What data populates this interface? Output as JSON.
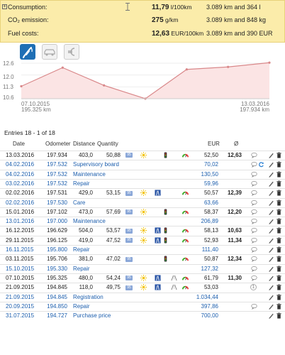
{
  "summary": {
    "rows": [
      {
        "label": "Consumption:",
        "value": "11,79",
        "unit": " l/100km",
        "total": "3.089 km and 364 l"
      },
      {
        "label": "CO₂ emission:",
        "value": "275",
        "unit": " g/km",
        "total": "3.089 km and 848 kg"
      },
      {
        "label": "Fuel costs:",
        "value": "12,63",
        "unit": " EUR/100km",
        "total": "3.089 km and 390 EUR"
      }
    ],
    "bg_color": "#fbecaa"
  },
  "tabs": [
    {
      "icon": "fuel-pump-icon",
      "active": true
    },
    {
      "icon": "car-icon",
      "active": false
    },
    {
      "icon": "euro-icon",
      "active": false
    }
  ],
  "chart_data": {
    "type": "area",
    "y_ticks": [
      "12.6",
      "12.0",
      "11.3",
      "10.6"
    ],
    "ylim": [
      10.6,
      12.6
    ],
    "values": [
      11.3,
      12.35,
      11.35,
      10.6,
      12.25,
      12.39,
      12.63
    ],
    "start_label": "07.10.2015",
    "start_sub": "195.325 km",
    "end_label": "13.03.2016",
    "end_sub": "197.934 km",
    "color": "#d9888a",
    "fill": "#fbe4e4"
  },
  "entries_info": "Entries 18 - 1 of 18",
  "table_headers": {
    "date": "Date",
    "odometer": "Odometer",
    "distance": "Distance",
    "quantity": "Quantity",
    "eur": "EUR",
    "avg": "Ø"
  },
  "rows": [
    {
      "date": "13.03.2016",
      "odo": "197.934",
      "dist": "403,0",
      "qty": "50,88",
      "label": "",
      "eur": "52,50",
      "avg": "12,63",
      "type": "fuel",
      "icons": [
        "fuel-type-badge",
        "sun-icon",
        "traffic-light-icon",
        "gauge-icon"
      ],
      "comment": true,
      "blue": false
    },
    {
      "date": "04.02.2016",
      "odo": "197.532",
      "dist": "",
      "qty": "",
      "label": "Supervisory board",
      "eur": "70,02",
      "avg": "",
      "type": "cost",
      "icons": [],
      "comment": true,
      "refresh": true,
      "blue": true
    },
    {
      "date": "04.02.2016",
      "odo": "197.532",
      "dist": "",
      "qty": "",
      "label": "Maintenance",
      "eur": "130,50",
      "avg": "",
      "type": "cost",
      "icons": [],
      "comment": true,
      "blue": true
    },
    {
      "date": "03.02.2016",
      "odo": "197.532",
      "dist": "",
      "qty": "",
      "label": "Repair",
      "eur": "59,96",
      "avg": "",
      "type": "cost",
      "icons": [],
      "comment": true,
      "blue": true
    },
    {
      "date": "02.02.2016",
      "odo": "197.531",
      "dist": "429,0",
      "qty": "53,15",
      "label": "",
      "eur": "50,57",
      "avg": "12,39",
      "type": "fuel",
      "icons": [
        "fuel-type-badge",
        "sun-icon",
        "highway-icon",
        "gauge-icon"
      ],
      "comment": true,
      "blue": false
    },
    {
      "date": "02.02.2016",
      "odo": "197.530",
      "dist": "",
      "qty": "",
      "label": "Care",
      "eur": "63,66",
      "avg": "",
      "type": "cost",
      "icons": [],
      "comment": true,
      "blue": true
    },
    {
      "date": "15.01.2016",
      "odo": "197.102",
      "dist": "473,0",
      "qty": "57,69",
      "label": "",
      "eur": "58,37",
      "avg": "12,20",
      "type": "fuel",
      "icons": [
        "fuel-type-badge",
        "sun-icon",
        "traffic-light-icon",
        "gauge-icon"
      ],
      "comment": true,
      "blue": false
    },
    {
      "date": "13.01.2016",
      "odo": "197.000",
      "dist": "",
      "qty": "",
      "label": "Maintenance",
      "eur": "206,89",
      "avg": "",
      "type": "cost",
      "icons": [],
      "comment": true,
      "blue": true
    },
    {
      "date": "16.12.2015",
      "odo": "196.629",
      "dist": "504,0",
      "qty": "53,57",
      "label": "",
      "eur": "58,13",
      "avg": "10,63",
      "type": "fuel",
      "icons": [
        "fuel-type-badge",
        "sun-icon",
        "highway-icon",
        "traffic-light-icon",
        "gauge-icon"
      ],
      "comment": true,
      "blue": false
    },
    {
      "date": "29.11.2015",
      "odo": "196.125",
      "dist": "419,0",
      "qty": "47,52",
      "label": "",
      "eur": "52,93",
      "avg": "11,34",
      "type": "fuel",
      "icons": [
        "fuel-type-badge",
        "sun-icon",
        "highway-icon",
        "traffic-light-icon",
        "gauge-icon"
      ],
      "comment": true,
      "blue": false
    },
    {
      "date": "16.11.2015",
      "odo": "195.800",
      "dist": "",
      "qty": "",
      "label": "Repair",
      "eur": "111,40",
      "avg": "",
      "type": "cost",
      "icons": [],
      "comment": true,
      "blue": true
    },
    {
      "date": "03.11.2015",
      "odo": "195.706",
      "dist": "381,0",
      "qty": "47,02",
      "label": "",
      "eur": "50,87",
      "avg": "12,34",
      "type": "fuel",
      "icons": [
        "fuel-type-badge",
        "traffic-light-icon",
        "gauge-icon"
      ],
      "comment": true,
      "blue": false
    },
    {
      "date": "15.10.2015",
      "odo": "195.330",
      "dist": "",
      "qty": "",
      "label": "Repair",
      "eur": "127,32",
      "avg": "",
      "type": "cost",
      "icons": [],
      "comment": true,
      "blue": true
    },
    {
      "date": "07.10.2015",
      "odo": "195.325",
      "dist": "480,0",
      "qty": "54,24",
      "label": "",
      "eur": "61,79",
      "avg": "11,30",
      "type": "fuel",
      "icons": [
        "fuel-type-badge",
        "sun-icon",
        "highway-icon",
        "road-icon",
        "gauge-icon"
      ],
      "comment": true,
      "blue": false
    },
    {
      "date": "21.09.2015",
      "odo": "194.845",
      "dist": "118,0",
      "qty": "49,75",
      "label": "",
      "eur": "53,03",
      "avg": "",
      "type": "fuel",
      "icons": [
        "fuel-type-badge",
        "sun-icon",
        "highway-icon",
        "road-icon",
        "gauge-icon"
      ],
      "comment": false,
      "info": "1",
      "blue": false
    },
    {
      "date": "21.09.2015",
      "odo": "194.845",
      "dist": "",
      "qty": "",
      "label": "Registration",
      "eur": "1.034,44",
      "avg": "",
      "type": "cost",
      "icons": [],
      "comment": false,
      "blue": true
    },
    {
      "date": "20.09.2015",
      "odo": "194.850",
      "dist": "",
      "qty": "",
      "label": "Repair",
      "eur": "397,86",
      "avg": "",
      "type": "cost",
      "icons": [],
      "comment": true,
      "blue": true
    },
    {
      "date": "31.07.2015",
      "odo": "194.727",
      "dist": "",
      "qty": "",
      "label": "Purchase price",
      "eur": "700,00",
      "avg": "",
      "type": "cost",
      "icons": [],
      "comment": false,
      "blue": true
    }
  ],
  "badge_text": "95"
}
